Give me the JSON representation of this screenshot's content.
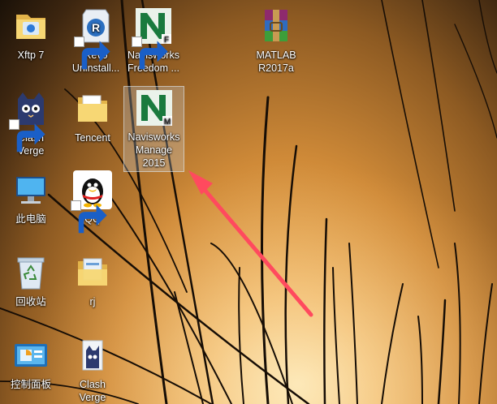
{
  "desktop": {
    "icons": [
      {
        "label": "Xftp 7",
        "icon": "folder-icon"
      },
      {
        "label": "Revo Uninstall...",
        "icon": "revo-uninstaller-icon"
      },
      {
        "label": "Navisworks Freedom ...",
        "icon": "navisworks-freedom-icon"
      },
      {
        "label": "MATLAB R2017a",
        "icon": "winrar-archive-icon"
      },
      {
        "label": "Clash Verge",
        "icon": "cat-app-icon"
      },
      {
        "label": "Tencent",
        "icon": "folder-icon"
      },
      {
        "label": "Navisworks Manage 2015",
        "icon": "navisworks-manage-icon",
        "selected": true
      },
      {
        "label": "此电脑",
        "icon": "computer-icon"
      },
      {
        "label": "QQ",
        "icon": "qq-penguin-icon"
      },
      {
        "label": "回收站",
        "icon": "recycle-bin-icon"
      },
      {
        "label": "rj",
        "icon": "folder-icon"
      },
      {
        "label": "控制面板",
        "icon": "control-panel-icon"
      },
      {
        "label": "Clash Verge",
        "icon": "cat-app-icon"
      }
    ]
  },
  "annotation": {
    "icon": "red-arrow-icon",
    "color": "#ff4a5e"
  },
  "colors": {
    "navisworks_green": "#1a7a3e",
    "selection": "#cddceb"
  }
}
